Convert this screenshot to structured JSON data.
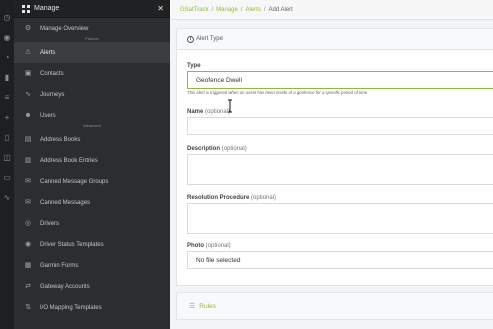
{
  "sidebar": {
    "title": "Manage",
    "close_glyph": "✕",
    "items": [
      {
        "label": "Manage Overview",
        "icon": "gear-icon",
        "glyph": "⚙"
      },
      {
        "label": "Alerts",
        "icon": "alert-triangle-icon",
        "glyph": "⚠",
        "active": true
      },
      {
        "label": "Contacts",
        "icon": "contact-card-icon",
        "glyph": "▣"
      },
      {
        "label": "Journeys",
        "icon": "route-icon",
        "glyph": "∿"
      },
      {
        "label": "Users",
        "icon": "users-icon",
        "glyph": "☻"
      },
      {
        "label": "Address Books",
        "icon": "book-icon",
        "glyph": "▤"
      },
      {
        "label": "Address Book Entries",
        "icon": "book-entries-icon",
        "glyph": "▥"
      },
      {
        "label": "Canned Message Groups",
        "icon": "message-group-icon",
        "glyph": "✉"
      },
      {
        "label": "Canned Messages",
        "icon": "message-icon",
        "glyph": "✉"
      },
      {
        "label": "Drivers",
        "icon": "steering-wheel-icon",
        "glyph": "◎"
      },
      {
        "label": "Driver Status Templates",
        "icon": "status-template-icon",
        "glyph": "◉"
      },
      {
        "label": "Garmin Forms",
        "icon": "form-icon",
        "glyph": "▦"
      },
      {
        "label": "Gateway Accounts",
        "icon": "gateway-icon",
        "glyph": "⇄"
      },
      {
        "label": "I/O Mapping Templates",
        "icon": "io-mapping-icon",
        "glyph": "⇅"
      }
    ],
    "section_planner": "Planner",
    "section_advanced": "Advanced"
  },
  "breadcrumb": {
    "items": [
      "GSatTrack",
      "Manage",
      "Alerts",
      "Add Alert"
    ],
    "separator": "/"
  },
  "panel": {
    "title": "Alert Type",
    "info_glyph": "i"
  },
  "form": {
    "type_label": "Type",
    "type_value": "Geofence Dwell",
    "type_help": "This alert is triggered when an asset has been inside of a geofence for a specific period of time.",
    "name_label": "Name",
    "name_opt": "(optional)",
    "name_value": "",
    "description_label": "Description",
    "description_opt": "(optional)",
    "description_value": "",
    "resolution_label": "Resolution Procedure",
    "resolution_opt": "(optional)",
    "resolution_value": "",
    "photo_label": "Photo",
    "photo_opt": "(optional)",
    "photo_value": "No file selected"
  },
  "rules": {
    "label": "Rules",
    "glyph": "☰"
  },
  "rail_icons": [
    "dashboard-icon",
    "map-icon",
    "clock-icon",
    "chart-icon",
    "list-icon",
    "plus-icon",
    "document-icon",
    "layers-icon",
    "truck-icon",
    "graph-icon"
  ],
  "colors": {
    "accent": "#8bbb3a",
    "sidebar_bg": "#2b2d30",
    "sidebar_active": "#3a3d40"
  }
}
